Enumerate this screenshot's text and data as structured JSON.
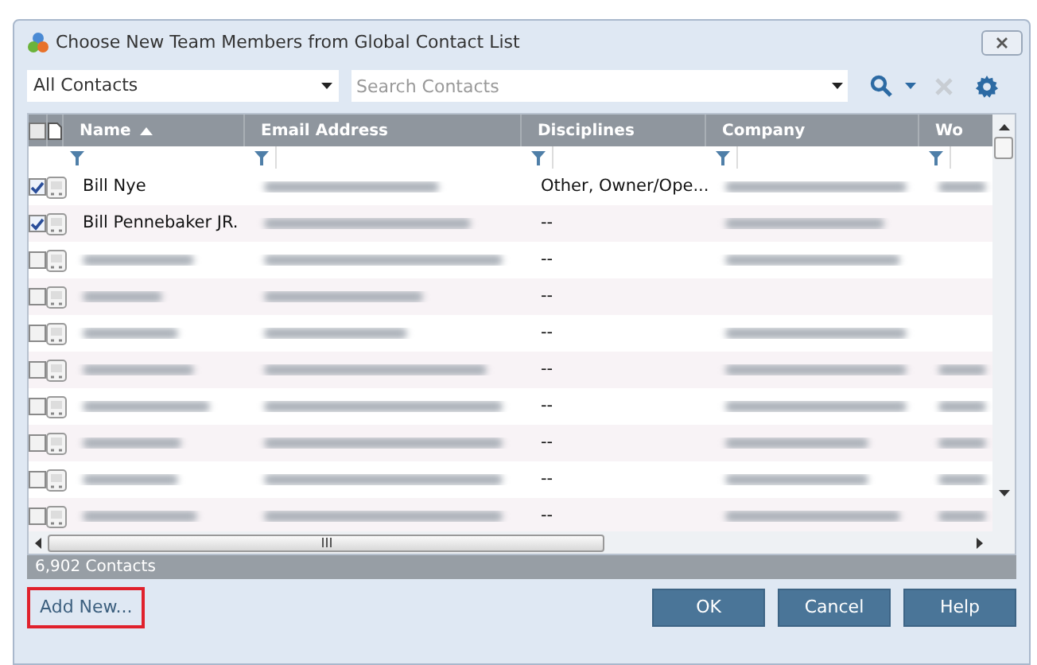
{
  "window": {
    "title": "Choose New Team Members from Global Contact List"
  },
  "toolbar": {
    "list_filter": "All Contacts",
    "search": {
      "placeholder": "Search Contacts"
    }
  },
  "table": {
    "select_all_checked": false,
    "columns": [
      {
        "label": "Name",
        "sorted": true
      },
      {
        "label": "Email Address",
        "sorted": false
      },
      {
        "label": "Disciplines",
        "sorted": false
      },
      {
        "label": "Company",
        "sorted": false
      },
      {
        "label": "Wo",
        "sorted": false
      }
    ],
    "rows": [
      {
        "checked": true,
        "name": "Bill Nye",
        "disciplines": "Other, Owner/Ope...",
        "blur_email": true,
        "blur_company": true,
        "blur_column_5": true
      },
      {
        "checked": true,
        "name": "Bill Pennebaker JR.",
        "disciplines": "--",
        "blur_email": true,
        "blur_company": true
      },
      {
        "checked": false,
        "disciplines": "--",
        "blur_name": true,
        "blur_email": true,
        "blur_company": true
      },
      {
        "checked": false,
        "disciplines": "--",
        "blur_name": true,
        "blur_email": true
      },
      {
        "checked": false,
        "disciplines": "--",
        "blur_name": true,
        "blur_email": true,
        "blur_company": true
      },
      {
        "checked": false,
        "disciplines": "--",
        "blur_name": true,
        "blur_email": true,
        "blur_company": true,
        "blur_column_5": true
      },
      {
        "checked": false,
        "disciplines": "--",
        "blur_name": true,
        "blur_email": true,
        "blur_company": true,
        "blur_column_5": true
      },
      {
        "checked": false,
        "disciplines": "--",
        "blur_name": true,
        "blur_email": true,
        "blur_company": true,
        "blur_column_5": true
      },
      {
        "checked": false,
        "disciplines": "--",
        "blur_name": true,
        "blur_email": true,
        "blur_company": true,
        "blur_column_5": true
      },
      {
        "checked": false,
        "disciplines": "--",
        "blur_name": true,
        "blur_email": true,
        "blur_company": true,
        "blur_column_5": true
      }
    ]
  },
  "status_bar": "6,902 Contacts",
  "buttons": [
    {
      "label": "Add New...",
      "highlighted": true
    },
    {
      "label": "OK",
      "highlighted": false
    },
    {
      "label": "Cancel",
      "highlighted": false
    },
    {
      "label": "Help",
      "highlighted": false
    }
  ]
}
